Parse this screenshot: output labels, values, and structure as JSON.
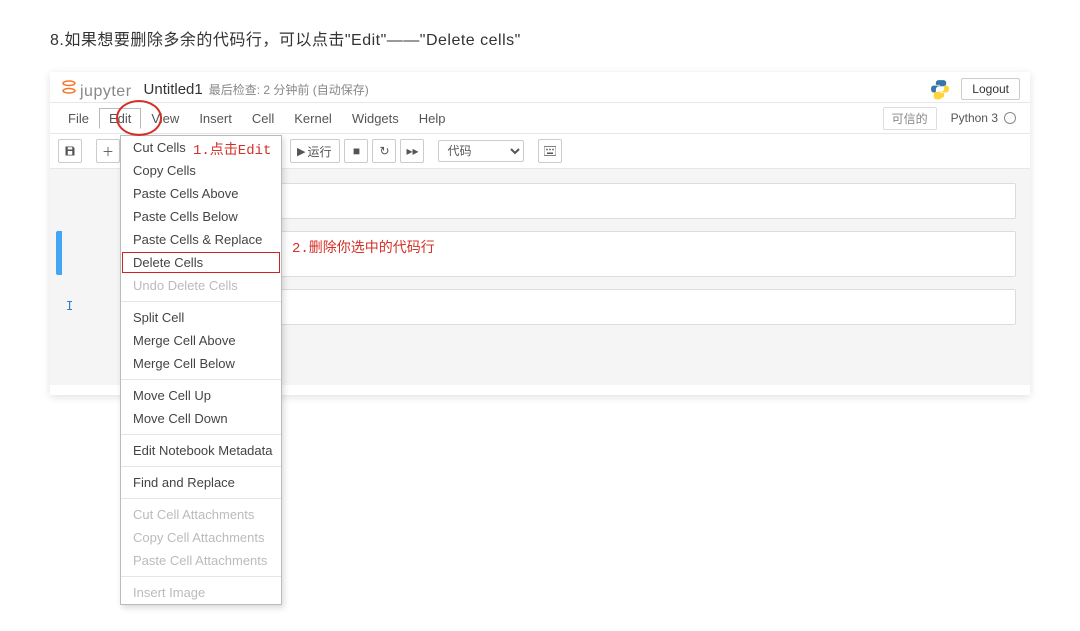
{
  "instruction": "8.如果想要删除多余的代码行，可以点击\"Edit\"——\"Delete cells\"",
  "header": {
    "logo_text": "jupyter",
    "notebook_title": "Untitled1",
    "checkpoint": "最后检查: 2 分钟前 (自动保存)",
    "logout": "Logout"
  },
  "menubar": {
    "items": [
      "File",
      "Edit",
      "View",
      "Insert",
      "Cell",
      "Kernel",
      "Widgets",
      "Help"
    ],
    "trusted": "可信的",
    "kernel": "Python 3"
  },
  "toolbar": {
    "run_label": "运行",
    "celltype": "代码"
  },
  "edit_menu": {
    "cut": "Cut Cells",
    "copy": "Copy Cells",
    "paste_above": "Paste Cells Above",
    "paste_below": "Paste Cells Below",
    "paste_replace": "Paste Cells & Replace",
    "delete": "Delete Cells",
    "undo_delete": "Undo Delete Cells",
    "split": "Split Cell",
    "merge_above": "Merge Cell Above",
    "merge_below": "Merge Cell Below",
    "move_up": "Move Cell Up",
    "move_down": "Move Cell Down",
    "edit_meta": "Edit Notebook Metadata",
    "find_replace": "Find and Replace",
    "cut_attach": "Cut Cell Attachments",
    "copy_attach": "Copy Cell Attachments",
    "paste_attach": "Paste Cell Attachments",
    "insert_image": "Insert Image"
  },
  "annotations": {
    "a1": "1.点击Edit",
    "a2": "2.删除你选中的代码行"
  },
  "prompts": {
    "in_marker": "I"
  }
}
